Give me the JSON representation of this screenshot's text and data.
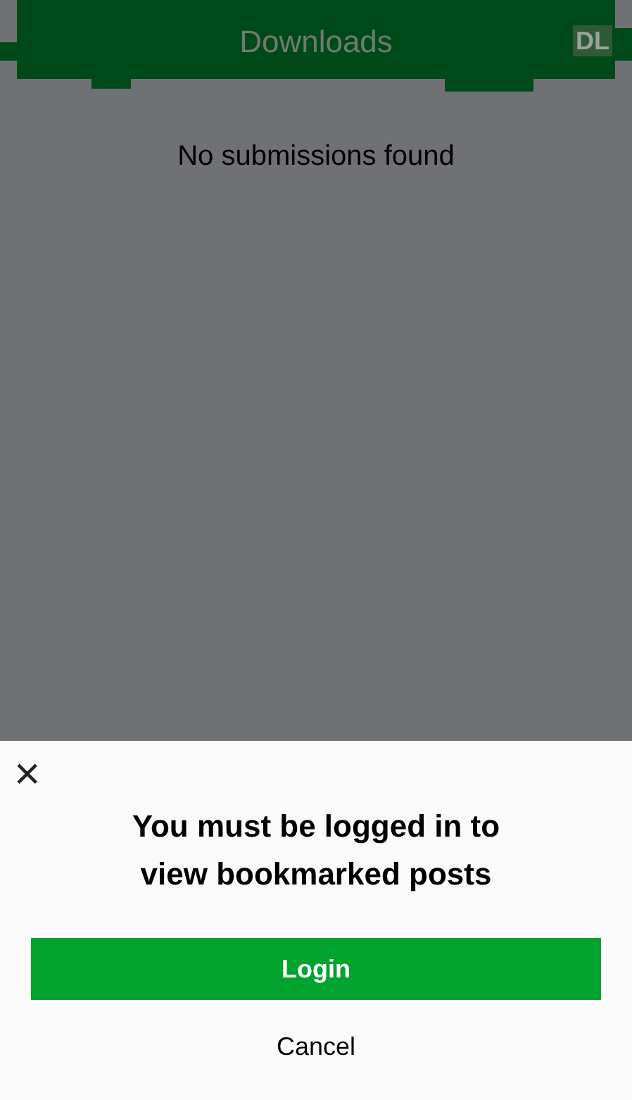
{
  "header": {
    "title": "Downloads",
    "logo": "DL"
  },
  "content": {
    "empty_message": "No submissions found"
  },
  "dialog": {
    "close": "×",
    "message": "You must be logged in to view bookmarked posts",
    "buttons": [
      {
        "label": "Login",
        "kind": "primary"
      },
      {
        "label": "Cancel",
        "kind": "text"
      }
    ]
  }
}
